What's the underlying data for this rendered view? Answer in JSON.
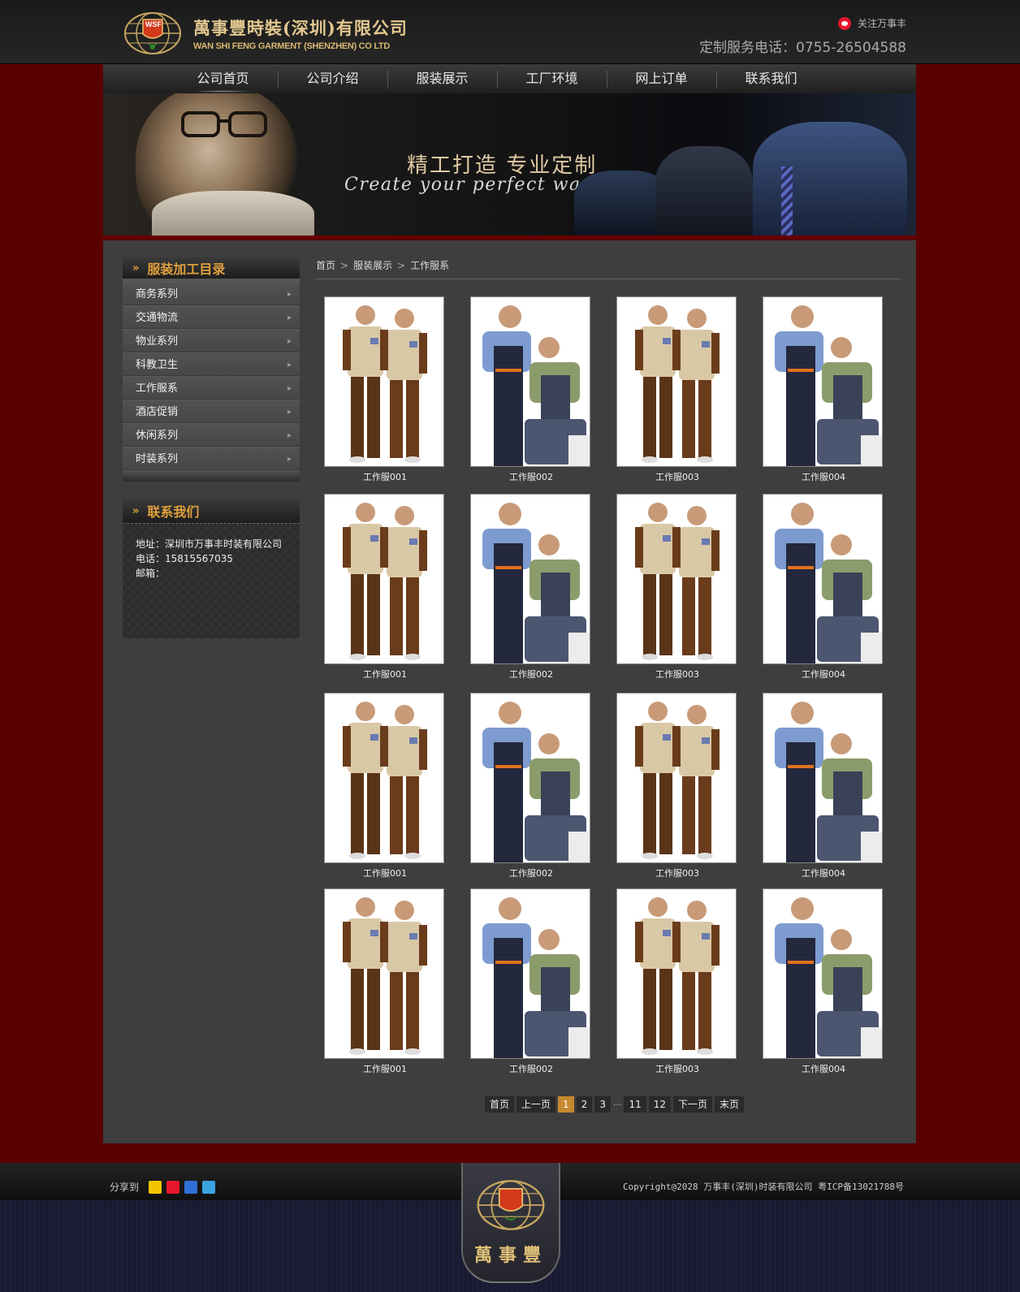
{
  "header": {
    "company_cn": "萬事豐時裝(深圳)有限公司",
    "company_en": "WAN SHI FENG GARMENT (SHENZHEN) CO LTD",
    "logo_text": "WSF",
    "follow": "关注万事丰",
    "hotline": "定制服务电话：0755-26504588"
  },
  "nav": [
    {
      "label": "公司首页"
    },
    {
      "label": "公司介绍"
    },
    {
      "label": "服装展示"
    },
    {
      "label": "工厂环境"
    },
    {
      "label": "网上订单"
    },
    {
      "label": "联系我们"
    }
  ],
  "banner": {
    "title": "精工打造 专业定制",
    "subtitle": "Create your perfect wardrobe"
  },
  "sidebar": {
    "catalog_title": "服装加工目录",
    "categories": [
      {
        "label": "商务系列"
      },
      {
        "label": "交通物流"
      },
      {
        "label": "物业系列"
      },
      {
        "label": "科教卫生"
      },
      {
        "label": "工作服系"
      },
      {
        "label": "酒店促销"
      },
      {
        "label": "休闲系列"
      },
      {
        "label": "时装系列"
      }
    ],
    "contact_title": "联系我们",
    "contact_address": "地址：深圳市万事丰时装有限公司",
    "contact_phone": "电话：15815567035",
    "contact_email": "邮箱："
  },
  "breadcrumb": [
    "首页",
    "服装展示",
    "工作服系"
  ],
  "products": [
    {
      "name": "工作服001",
      "type": "jacket"
    },
    {
      "name": "工作服002",
      "type": "overall"
    },
    {
      "name": "工作服003",
      "type": "jacket"
    },
    {
      "name": "工作服004",
      "type": "overall"
    },
    {
      "name": "工作服001",
      "type": "jacket"
    },
    {
      "name": "工作服002",
      "type": "overall"
    },
    {
      "name": "工作服003",
      "type": "jacket"
    },
    {
      "name": "工作服004",
      "type": "overall"
    },
    {
      "name": "工作服001",
      "type": "jacket"
    },
    {
      "name": "工作服002",
      "type": "overall"
    },
    {
      "name": "工作服003",
      "type": "jacket"
    },
    {
      "name": "工作服004",
      "type": "overall"
    },
    {
      "name": "工作服001",
      "type": "jacket"
    },
    {
      "name": "工作服002",
      "type": "overall"
    },
    {
      "name": "工作服003",
      "type": "jacket"
    },
    {
      "name": "工作服004",
      "type": "overall"
    }
  ],
  "pager": {
    "first": "首页",
    "prev": "上一页",
    "pages": [
      "1",
      "2",
      "3"
    ],
    "dots": "···",
    "tail_pages": [
      "11",
      "12"
    ],
    "next": "下一页",
    "last": "末页",
    "current": "1"
  },
  "footer": {
    "share_label": "分享到",
    "share_icons": [
      "qzone-icon",
      "sina-weibo-icon",
      "baidu-icon",
      "tencent-weibo-icon"
    ],
    "copyright": "Copyright@2028 万事丰(深圳)时装有限公司 粤ICP备13021788号",
    "badge_text": "萬事豐"
  },
  "colors": {
    "brand_red": "#5a0000",
    "accent_gold": "#e0a03c",
    "pager_active": "#c7892f"
  }
}
